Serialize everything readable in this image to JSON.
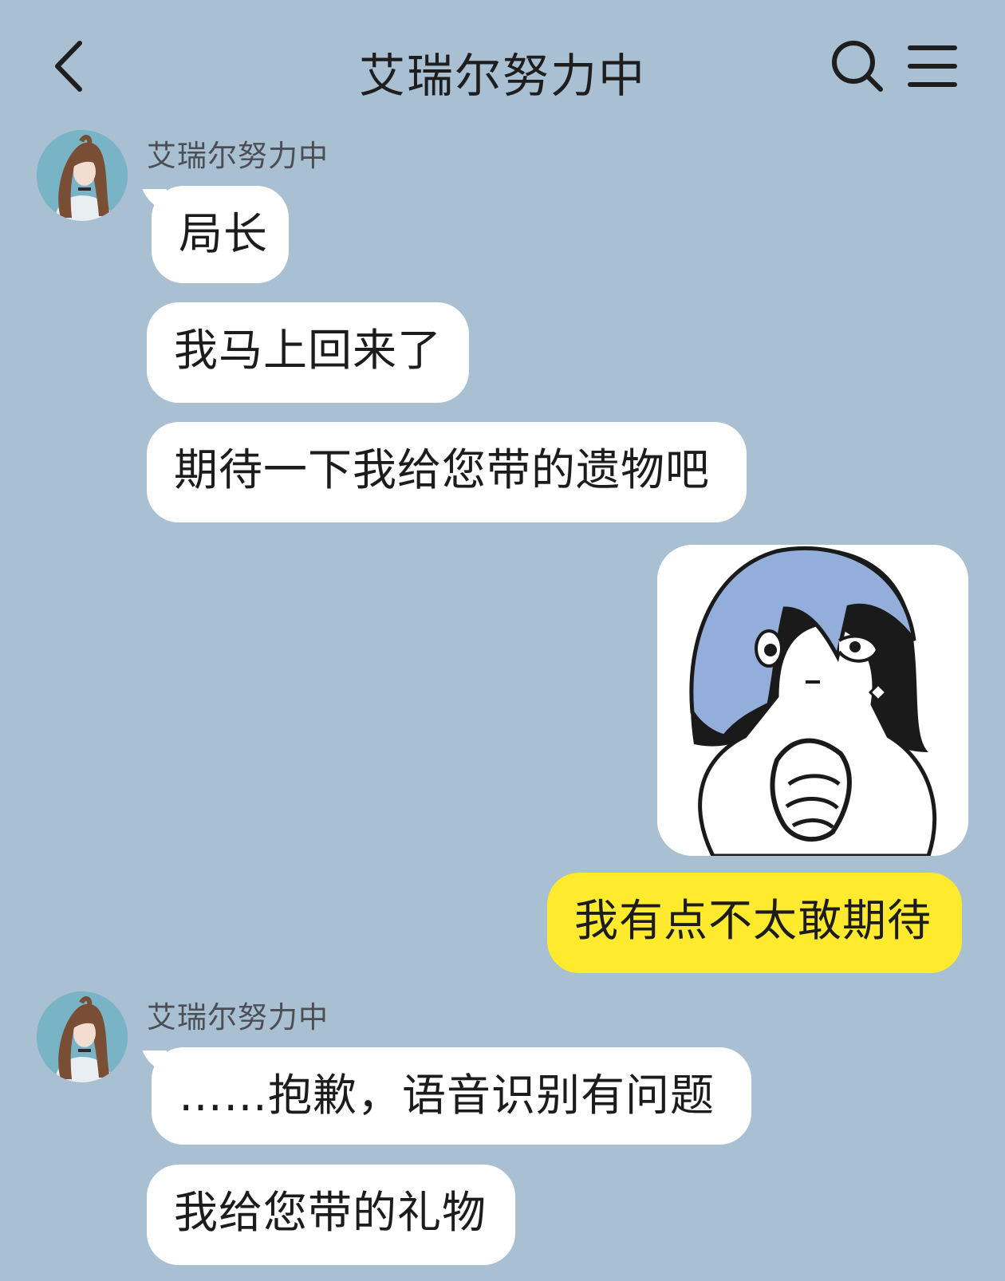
{
  "header": {
    "title": "艾瑞尔努力中",
    "back_icon": "chevron-left-icon",
    "search_icon": "search-icon",
    "menu_icon": "menu-icon"
  },
  "colors": {
    "background": "#a9bfd2",
    "incoming_bubble": "#ffffff",
    "outgoing_bubble": "#ffea2e"
  },
  "messages": {
    "group1": {
      "sender": "艾瑞尔努力中",
      "items": [
        "局长",
        "我马上回来了",
        "期待一下我给您带的遗物吧"
      ]
    },
    "mine": {
      "sticker": "praying-hands-sticker",
      "text": "我有点不太敢期待"
    },
    "group2": {
      "sender": "艾瑞尔努力中",
      "items": [
        "……抱歉，语音识别有问题",
        "我给您带的礼物"
      ]
    }
  }
}
